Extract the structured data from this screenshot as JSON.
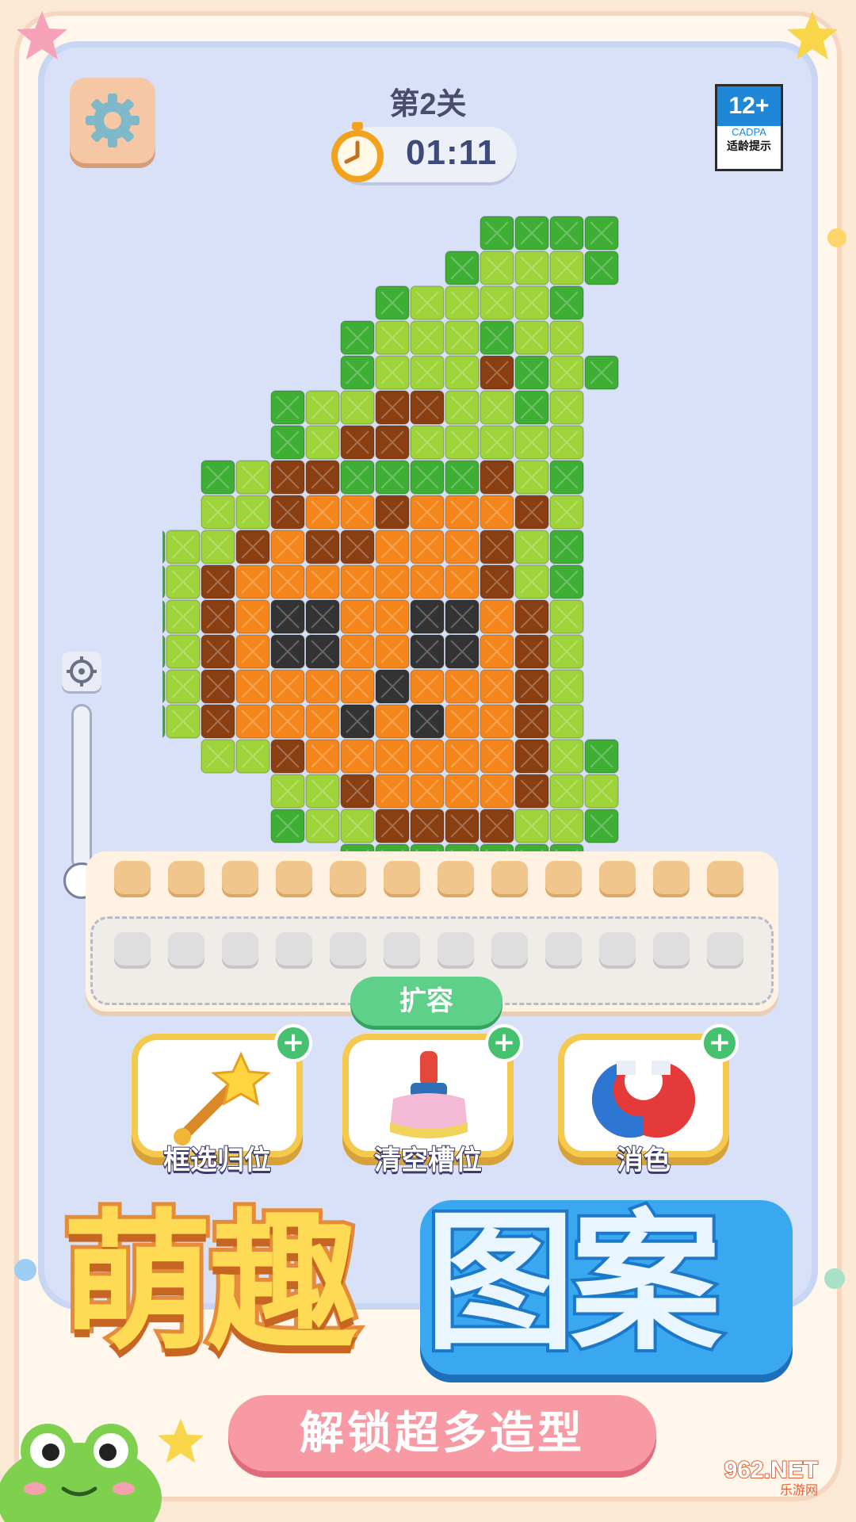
{
  "level": {
    "title": "第2关"
  },
  "timer": {
    "value": "01:11"
  },
  "age_rating": {
    "value": "12+",
    "org": "CADPA",
    "note": "适龄提示"
  },
  "expand_button": {
    "label": "扩容"
  },
  "slots": {
    "filled_count": 12,
    "empty_count": 12
  },
  "tools": [
    {
      "label": "框选归位",
      "icon": "magic-wand-icon"
    },
    {
      "label": "清空槽位",
      "icon": "brush-icon"
    },
    {
      "label": "消色",
      "icon": "magnet-icon"
    }
  ],
  "banner": {
    "left": "萌趣",
    "right": "图案"
  },
  "subtitle": "解锁超多造型",
  "watermark": {
    "brand": "962.NET",
    "sub": "乐游网"
  },
  "colors": {
    "dark_green": "#3fae35",
    "light_green": "#9fd33a",
    "orange": "#f4861c",
    "brown": "#8a3f13",
    "black": "#333333"
  },
  "pixel_grid": [
    "......DDDD.",
    ".....DLLLD.",
    "....DLLLLD.",
    "...DLLLDLL.",
    "...DLLLBDLD",
    "..DLLBBLLDL",
    "..DLBBLLLLL",
    ".DLBBDDDDBLD",
    ".LLBOOBOOOBL",
    "DLLBOBBOOOBLD",
    "DLBOOOOOOOBLD",
    "DLBOKKOOKKOBL",
    "DLBOKKOOKKOBL",
    "DLBOOOOKOOOBL",
    "DLBOOOKOKOOBL",
    ".LLBOOOOOOBLD",
    "..LLBOOOOBLL",
    "..DLLBBBBLLD",
    "...DDDDDDD"
  ]
}
